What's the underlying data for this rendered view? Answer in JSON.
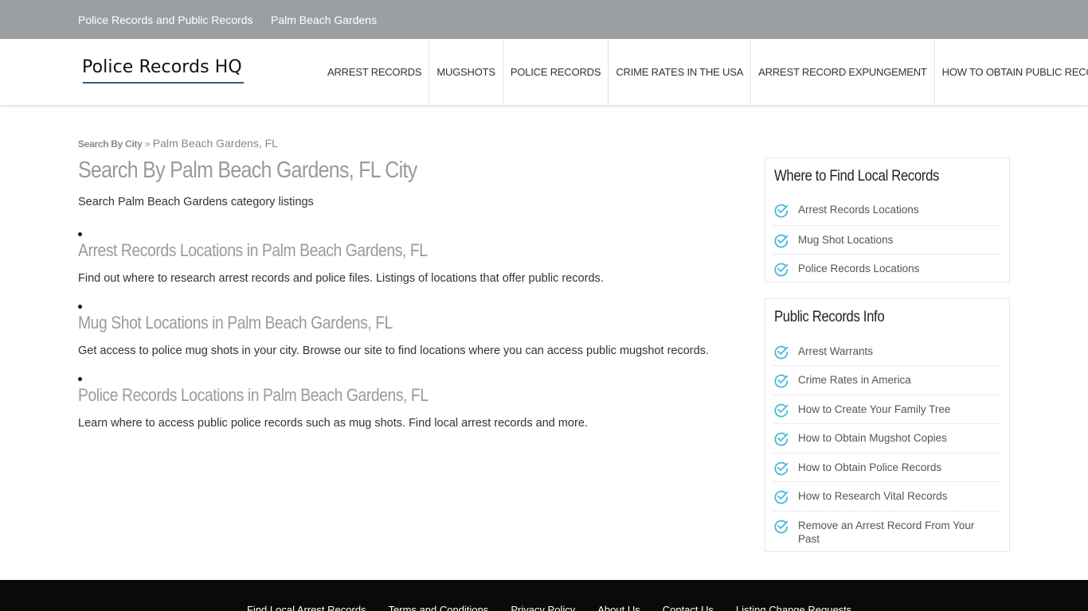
{
  "topbar": {
    "links": [
      "Police Records and Public Records",
      "Palm Beach Gardens"
    ]
  },
  "header": {
    "logo_text": "Police Records HQ",
    "nav": [
      "Arrest Records",
      "Mugshots",
      "Police Records",
      "Crime Rates In The USA",
      "Arrest Record Expungement",
      "How To Obtain Public Records"
    ]
  },
  "breadcrumb": {
    "link": "Search By City",
    "separator": "»",
    "current": "Palm Beach Gardens, FL"
  },
  "main": {
    "title": "Search By Palm Beach Gardens, FL City",
    "intro": "Search Palm Beach Gardens category listings",
    "listings": [
      {
        "title": "Arrest Records Locations in Palm Beach Gardens, FL",
        "description": "Find out where to research arrest records and police files. Listings of locations that offer public records."
      },
      {
        "title": "Mug Shot Locations in Palm Beach Gardens, FL",
        "description": "Get access to police mug shots in your city. Browse our site to find locations where you can access public mugshot records."
      },
      {
        "title": "Police Records Locations in Palm Beach Gardens, FL",
        "description": "Learn where to access public police records such as mug shots. Find local arrest records and more."
      }
    ]
  },
  "sidebar": {
    "widgets": [
      {
        "title": "Where to Find Local Records",
        "items": [
          "Arrest Records Locations",
          "Mug Shot Locations",
          "Police Records Locations"
        ]
      },
      {
        "title": "Public Records Info",
        "items": [
          "Arrest Warrants",
          "Crime Rates in America",
          "How to Create Your Family Tree",
          "How to Obtain Mugshot Copies",
          "How to Obtain Police Records",
          "How to Research Vital Records",
          "Remove an Arrest Record From Your Past"
        ]
      }
    ]
  },
  "footer": {
    "links": [
      "Find Local Arrest Records",
      "Terms and Conditions",
      "Privacy Policy",
      "About Us",
      "Contact Us",
      "Listing Change Requests"
    ]
  },
  "colors": {
    "topbar": "#9c9fa2",
    "accent_check": "#4ab8d6",
    "logo_underline": "#2b5f8a",
    "footer": "#0a0a0a"
  }
}
